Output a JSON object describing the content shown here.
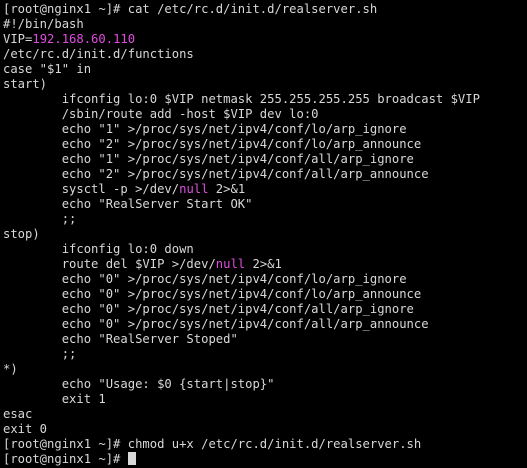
{
  "terminal": {
    "colors": {
      "background": "#000000",
      "text": "#d8d8d8",
      "highlight": "#e04ce0"
    },
    "lines": [
      [
        {
          "t": "[root@nginx1 ~]# cat /etc/rc.d/init.d/realserver.sh"
        }
      ],
      [
        {
          "t": "#!/bin/bash"
        }
      ],
      [
        {
          "t": "VIP="
        },
        {
          "t": "192.168.60.110",
          "c": "magenta"
        }
      ],
      [
        {
          "t": "/etc/rc.d/init.d/functions"
        }
      ],
      [
        {
          "t": "case \"$1\" in"
        }
      ],
      [
        {
          "t": "start)"
        }
      ],
      [
        {
          "t": "        ifconfig lo:0 $VIP netmask 255.255.255.255 broadcast $VIP"
        }
      ],
      [
        {
          "t": "        /sbin/route add -host $VIP dev lo:0"
        }
      ],
      [
        {
          "t": "        echo \"1\" >/proc/sys/net/ipv4/conf/lo/arp_ignore"
        }
      ],
      [
        {
          "t": "        echo \"2\" >/proc/sys/net/ipv4/conf/lo/arp_announce"
        }
      ],
      [
        {
          "t": "        echo \"1\" >/proc/sys/net/ipv4/conf/all/arp_ignore"
        }
      ],
      [
        {
          "t": "        echo \"2\" >/proc/sys/net/ipv4/conf/all/arp_announce"
        }
      ],
      [
        {
          "t": "        sysctl -p >/dev/"
        },
        {
          "t": "null",
          "c": "magenta"
        },
        {
          "t": " 2>&1"
        }
      ],
      [
        {
          "t": "        echo \"RealServer Start OK\""
        }
      ],
      [
        {
          "t": "        ;;"
        }
      ],
      [
        {
          "t": "stop)"
        }
      ],
      [
        {
          "t": "        ifconfig lo:0 down"
        }
      ],
      [
        {
          "t": "        route del $VIP >/dev/"
        },
        {
          "t": "null",
          "c": "magenta"
        },
        {
          "t": " 2>&1"
        }
      ],
      [
        {
          "t": "        echo \"0\" >/proc/sys/net/ipv4/conf/lo/arp_ignore"
        }
      ],
      [
        {
          "t": "        echo \"0\" >/proc/sys/net/ipv4/conf/lo/arp_announce"
        }
      ],
      [
        {
          "t": "        echo \"0\" >/proc/sys/net/ipv4/conf/all/arp_ignore"
        }
      ],
      [
        {
          "t": "        echo \"0\" >/proc/sys/net/ipv4/conf/all/arp_announce"
        }
      ],
      [
        {
          "t": "        echo \"RealServer Stoped\""
        }
      ],
      [
        {
          "t": "        ;;"
        }
      ],
      [
        {
          "t": "*)"
        }
      ],
      [
        {
          "t": "        echo \"Usage: $0 {start|stop}\""
        }
      ],
      [
        {
          "t": "        exit 1"
        }
      ],
      [
        {
          "t": "esac"
        }
      ],
      [
        {
          "t": "exit 0"
        }
      ],
      [
        {
          "t": "[root@nginx1 ~]# chmod u+x /etc/rc.d/init.d/realserver.sh"
        }
      ],
      [
        {
          "t": "[root@nginx1 ~]# "
        }
      ]
    ]
  }
}
